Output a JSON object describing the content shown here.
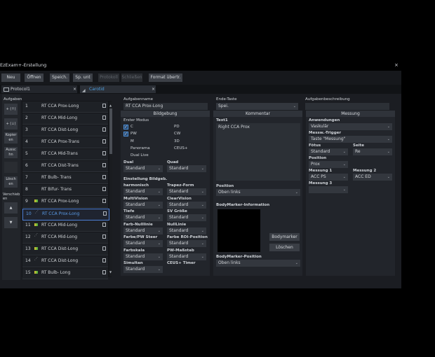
{
  "window": {
    "title": "EzExam+-Erstellung",
    "close": "×"
  },
  "toolbar": {
    "neu": "Neu",
    "oeffnen": "Öffnen",
    "speich": "Speich.",
    "sp_unt": "Sp. unt",
    "disabled1": "Protokoll",
    "disabled2": "Schließen",
    "format": "Format übertr."
  },
  "tabs": [
    {
      "label": "Protocol1",
      "close": "×"
    },
    {
      "label": "Carotid",
      "close": "×"
    }
  ],
  "side": {
    "heading": "Aufgaben",
    "add_top": "+ (↑)",
    "add_bottom": "+ (↓)",
    "copy": "Kopier en",
    "cut": "Aussc hn",
    "delete": "Lösch en",
    "move": "Verschieb en",
    "up": "▲",
    "down": "▼"
  },
  "tasks": [
    {
      "num": "1",
      "label": "RT CCA Prox-Long",
      "icon": ""
    },
    {
      "num": "2",
      "label": "RT CCA Mid-Long",
      "icon": ""
    },
    {
      "num": "3",
      "label": "RT CCA Dist-Long",
      "icon": ""
    },
    {
      "num": "4",
      "label": "RT CCA Prox-Trans",
      "icon": ""
    },
    {
      "num": "5",
      "label": "RT CCA Mid-Trans",
      "icon": ""
    },
    {
      "num": "6",
      "label": "RT CCA Dist-Trans",
      "icon": ""
    },
    {
      "num": "7",
      "label": "RT Bulb- Trans",
      "icon": ""
    },
    {
      "num": "8",
      "label": "RT Bifur- Trans",
      "icon": ""
    },
    {
      "num": "9",
      "label": "RT CCA Prox-Long",
      "icon": "color"
    },
    {
      "num": "10",
      "label": "RT CCA Prox-Long",
      "icon": "pw"
    },
    {
      "num": "11",
      "label": "RT CCA Mid-Long",
      "icon": "color"
    },
    {
      "num": "12",
      "label": "RT CCA Mid-Long",
      "icon": "pw"
    },
    {
      "num": "13",
      "label": "RT CCA Dist-Long",
      "icon": "color"
    },
    {
      "num": "14",
      "label": "RT CCA Dist-Long",
      "icon": "pw"
    },
    {
      "num": "15",
      "label": "RT Bulb- Long",
      "icon": "color"
    }
  ],
  "task_name": {
    "label": "Aufgabenname",
    "value": "RT CCA Prox-Long"
  },
  "end_key": {
    "label": "Ende-Taste",
    "value": "Spei."
  },
  "task_desc": {
    "label": "Aufgabenbeschreibung",
    "value": ""
  },
  "imaging": {
    "header": "Bildgebung",
    "first_mode": "Erster Modus",
    "modes_left": [
      "C",
      "PW",
      "M",
      "Panorama",
      "Dual Live"
    ],
    "modes_right": [
      "PD",
      "CW",
      "3D",
      "CEUS+"
    ],
    "dual": {
      "label": "Dual",
      "value": "Standard"
    },
    "quad": {
      "label": "Quad",
      "value": "Standard"
    },
    "settings_title": "Einstellung Bildgeb.",
    "fields": [
      {
        "label": "harmonisch",
        "value": "Standard"
      },
      {
        "label": "Trapez-Form",
        "value": "Standard"
      },
      {
        "label": "MultiVision",
        "value": "Standard"
      },
      {
        "label": "ClearVision",
        "value": "Standard"
      },
      {
        "label": "Tiefe",
        "value": "Standard"
      },
      {
        "label": "SV Größe",
        "value": "Standard"
      },
      {
        "label": "Farb-Nulllinie",
        "value": "Standard"
      },
      {
        "label": "NullLinie",
        "value": "Standard"
      },
      {
        "label": "Farbe/PW Steer",
        "value": "Standard"
      },
      {
        "label": "Farbe ROI-Position",
        "value": "Standard"
      },
      {
        "label": "Farbskala",
        "value": "Standard"
      },
      {
        "label": "PW-Maßstab",
        "value": "Standard"
      },
      {
        "label": "Simultan",
        "value": "Standard"
      },
      {
        "label": "CEUS+ Timer",
        "value": ""
      }
    ]
  },
  "comment": {
    "header": "Kommentar",
    "text1_label": "Text1",
    "text1_value": "Right CCA Prox",
    "position_label": "Position",
    "position_value": "Oben links",
    "bodymarker_info": "BodyMarker-Information",
    "bodymarker_btn": "Bodymarker",
    "delete_btn": "Löschen",
    "bodymarker_pos_label": "BodyMarker-Position",
    "bodymarker_pos_value": "Oben links"
  },
  "measurement": {
    "header": "Messung",
    "applications_label": "Anwendungen",
    "applications_value": "Vaskulär",
    "trigger_label": "Messw.-Trigger",
    "trigger_value": "Taste \"Messung\"",
    "fetus_label": "Fötus",
    "fetus_value": "Standard",
    "side_label": "Seite",
    "side_value": "Re",
    "position_label": "Position",
    "position_value": "Prox",
    "m1_label": "Messung 1",
    "m1_value": "ACC PS",
    "m2_label": "Messung 2",
    "m2_value": "ACC ED",
    "m3_label": "Messung 3",
    "m3_value": ""
  },
  "colors": {
    "accent": "#4d9fe0",
    "panel": "#22252b",
    "control": "#33373e"
  }
}
